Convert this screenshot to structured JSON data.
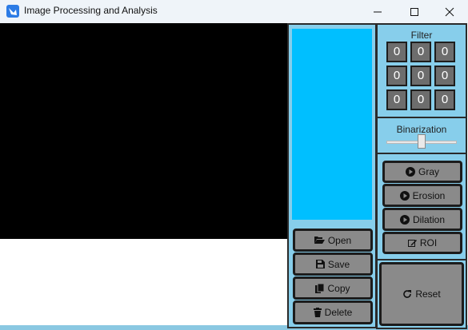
{
  "window": {
    "title": "Image Processing and Analysis",
    "controls": [
      "minimize-icon",
      "maximize-icon",
      "close-icon"
    ]
  },
  "colors": {
    "panel": "#87ceeb",
    "preview": "#00bfff",
    "button": "#8a8a8a",
    "cell": "#6d6d6d",
    "canvas": "#000000"
  },
  "filter": {
    "label": "Filter",
    "cells": [
      [
        "0",
        "0",
        "0"
      ],
      [
        "0",
        "0",
        "0"
      ],
      [
        "0",
        "0",
        "0"
      ]
    ]
  },
  "binarization": {
    "label": "Binarization",
    "level": 0.5
  },
  "file_buttons": [
    {
      "label": "Open",
      "icon": "folder-open-icon"
    },
    {
      "label": "Save",
      "icon": "save-icon"
    },
    {
      "label": "Copy",
      "icon": "copy-icon"
    },
    {
      "label": "Delete",
      "icon": "trash-icon"
    }
  ],
  "operation_buttons": [
    {
      "label": "Gray",
      "icon": "play-circle-icon"
    },
    {
      "label": "Erosion",
      "icon": "play-circle-icon"
    },
    {
      "label": "Dilation",
      "icon": "play-circle-icon"
    },
    {
      "label": "ROI",
      "icon": "edit-icon"
    }
  ],
  "reset": {
    "label": "Reset",
    "icon": "refresh-icon"
  }
}
